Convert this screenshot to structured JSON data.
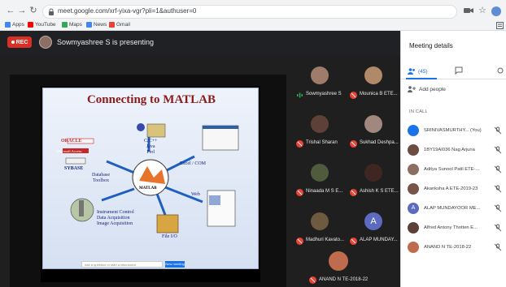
{
  "browser": {
    "url": "meet.google.com/xrf-yixa-vgr?pli=1&authuser=0",
    "bookmarks": [
      {
        "label": "Apps",
        "icon": "apps-grid-icon",
        "color": "#5f6368"
      },
      {
        "label": "YouTube",
        "icon": "youtube-icon",
        "color": "#ff0000"
      },
      {
        "label": "Maps",
        "icon": "maps-icon",
        "color": "#34a853"
      },
      {
        "label": "News",
        "icon": "news-icon",
        "color": "#4285f4"
      },
      {
        "label": "Gmail",
        "icon": "gmail-icon",
        "color": "#ea4335"
      }
    ]
  },
  "meeting": {
    "rec_label": "REC",
    "presenter_text": "Sowmyashree S is presenting"
  },
  "slide": {
    "title": "Connecting to MATLAB",
    "labels": {
      "oracle": "ORACLE",
      "access": "Microsoft Access",
      "sybase": "SYBASE",
      "database_toolbox": "Database\nToolbox",
      "languages": "C/C++\nJava\nPerl",
      "excel_com": "Excel / COM",
      "web": "Web",
      "file_io": "File I/O",
      "instrument": "Instrument Control\nData Acquisition\nImage Acquisition",
      "matlab": "MATLAB"
    },
    "search_placeholder": "Ask a question or start a discussion",
    "search_button": "New meeting"
  },
  "tiles": [
    {
      "name": "Sowmyashree S",
      "muted": false,
      "avatar": "#9e7b6a"
    },
    {
      "name": "Mounica B ETE...",
      "muted": true,
      "avatar": "#b08968"
    },
    {
      "name": "Trishal Sharan",
      "muted": true,
      "avatar": "#5d4037"
    },
    {
      "name": "Sukhad Deshpa...",
      "muted": true,
      "avatar": "#a1887f"
    },
    {
      "name": "Ninaada M S E...",
      "muted": true,
      "avatar": "#4e5b3c"
    },
    {
      "name": "Ashish K S ETE...",
      "muted": true,
      "avatar": "#3e2723"
    },
    {
      "name": "Madhuri Kavato...",
      "muted": true,
      "avatar": "#6d5a3f"
    },
    {
      "name": "ALAP MUNDAY...",
      "muted": true,
      "avatar": "#5c6bc0",
      "initial": "A"
    }
  ],
  "main_tile": {
    "name": "ANAND N TE-2018-22",
    "avatar": "#bf6b4d"
  },
  "panel": {
    "title": "Meeting details",
    "people_count": "(45)",
    "add_people": "Add people",
    "in_call": "IN CALL",
    "participants": [
      {
        "name": "SRINIVASMURTHY... (You)",
        "avatar": "#1a73e8"
      },
      {
        "name": "1BY19AI036 Nag Arjuna",
        "avatar": "#6d4c41"
      },
      {
        "name": "Aditya Sunool Patil ETE-...",
        "avatar": "#8d6e63"
      },
      {
        "name": "Akanksha A ETE-2019-23",
        "avatar": "#795548"
      },
      {
        "name": "ALAP MUNDAYOOR ME...",
        "avatar": "#5c6bc0",
        "initial": "A"
      },
      {
        "name": "Alfred Antony Thotten E...",
        "avatar": "#5d4037"
      },
      {
        "name": "ANAND N TE-2018-22",
        "avatar": "#bf6b4d"
      }
    ]
  }
}
